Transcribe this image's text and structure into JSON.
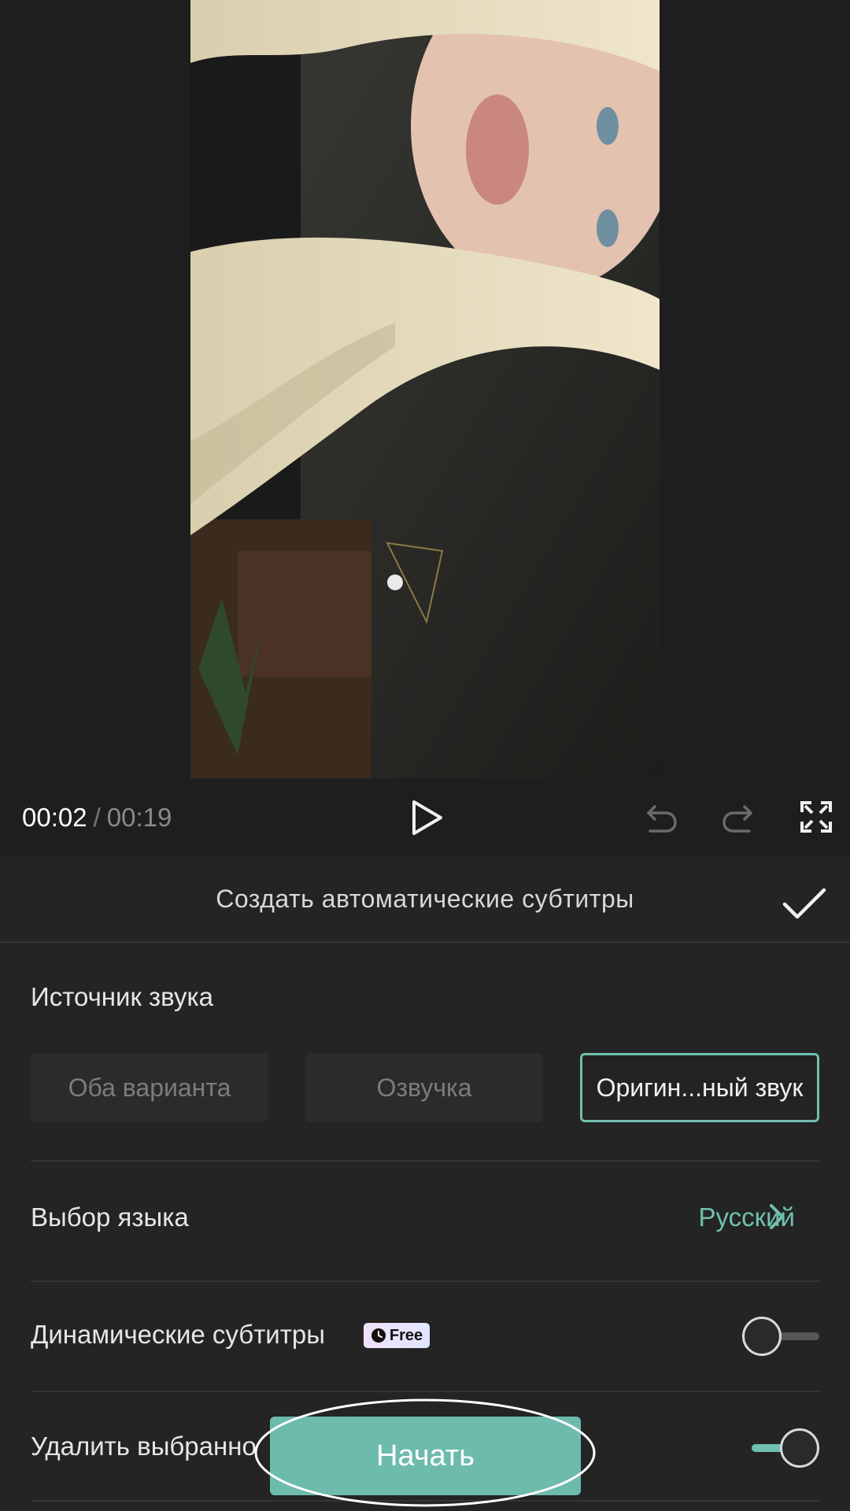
{
  "player": {
    "current_time": "00:02",
    "separator": "/",
    "total_time": "00:19"
  },
  "sheet": {
    "title": "Создать автоматические субтитры",
    "source": {
      "label": "Источник звука",
      "options": [
        "Оба варианта",
        "Озвучка",
        "Оригин...ный звук"
      ],
      "selected": "Оригин...ный звук"
    },
    "language": {
      "label": "Выбор языка",
      "value": "Русский"
    },
    "dynamic_subtitles": {
      "label": "Динамические субтитры",
      "badge": "Free",
      "enabled": false
    },
    "delete_selected": {
      "label": "Удалить выбранно",
      "enabled": true
    },
    "start_label": "Начать"
  },
  "colors": {
    "accent": "#6fc0ad",
    "button": "#6dbbac",
    "background": "#1e1e1e",
    "sheet": "#242424"
  },
  "icons": [
    "play-icon",
    "undo-icon",
    "redo-icon",
    "fullscreen-icon",
    "checkmark-icon",
    "chevron-right-icon",
    "clock-icon"
  ]
}
